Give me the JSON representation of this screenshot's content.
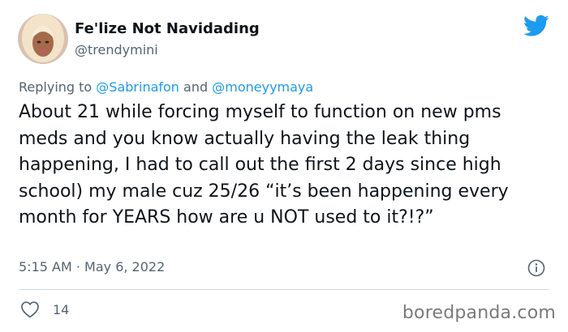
{
  "tweet": {
    "author": {
      "display_name": "Fe'lize Not Navidading",
      "handle": "@trendymini"
    },
    "reply": {
      "prefix": "Replying to ",
      "mention_1": "@Sabrinafon",
      "joiner": " and ",
      "mention_2": "@moneyymaya"
    },
    "text": "About 21 while forcing myself to function on new pms meds and you know actually having the leak thing happening, I had to call out the first 2 days since high school) my male cuz 25/26 “it’s been happening every month for YEARS how are u NOT used to it?!?”",
    "timestamp": "5:15 AM · May 6, 2022",
    "likes": "14"
  },
  "icons": {
    "logo": "twitter-bird-icon",
    "info": "info-icon",
    "like": "heart-icon"
  },
  "colors": {
    "twitter_blue": "#1d9bf0",
    "secondary_text": "#536471",
    "primary_text": "#0f1419"
  },
  "watermark": "boredpanda.com"
}
